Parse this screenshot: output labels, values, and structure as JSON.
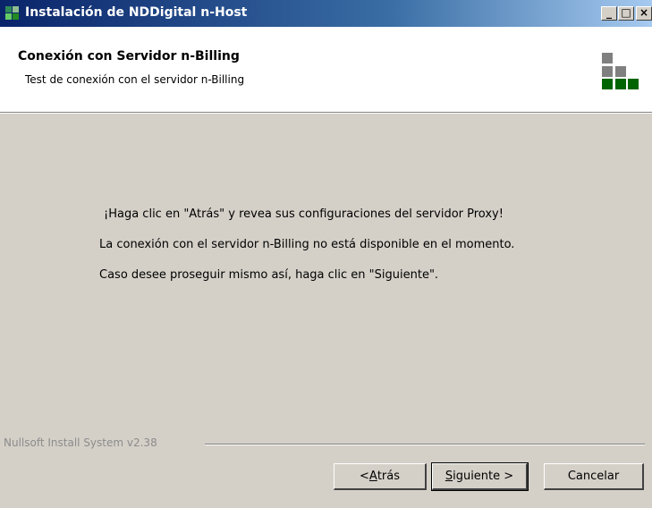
{
  "window": {
    "title": "Instalación de NDDigital n-Host",
    "controls": {
      "minimize": "_",
      "maximize": "□",
      "close": "×"
    }
  },
  "header": {
    "title": "Conexión con Servidor n-Billing",
    "subtitle": "Test de conexión con el servidor n-Billing",
    "logo_colors": {
      "gray": "#808080",
      "green": "#006400"
    }
  },
  "body": {
    "lines": [
      "¡Haga clic en \"Atrás\" y revea sus configuraciones del servidor Proxy!",
      "La conexión con el servidor n-Billing no está disponible en el momento.",
      "Caso desee proseguir mismo así, haga clic en \"Siguiente\"."
    ]
  },
  "footer": {
    "branding": "Nullsoft Install System v2.38",
    "buttons": {
      "back": {
        "prefix": "< ",
        "accel": "A",
        "rest": "trás"
      },
      "next": {
        "accel": "S",
        "rest": "iguiente >"
      },
      "cancel": "Cancelar"
    }
  }
}
